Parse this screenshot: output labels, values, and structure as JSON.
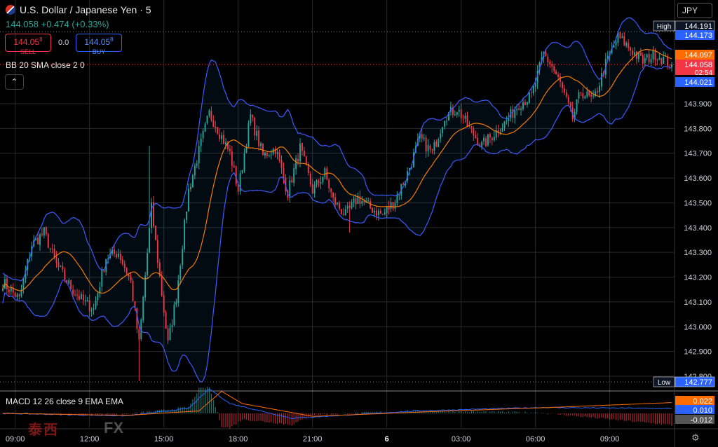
{
  "header": {
    "title": "U.S. Dollar / Japanese Yen · 5",
    "price": "144.058",
    "change": "+0.474",
    "change_pct": "(+0.33%)"
  },
  "trade": {
    "sell_price": "144.05",
    "sell_sup": "8",
    "sell_label": "SELL",
    "spread": "0.0",
    "buy_price": "144.05",
    "buy_sup": "8",
    "buy_label": "BUY"
  },
  "indicators": {
    "bb_label": "BB 20 SMA close 2 0",
    "macd_label": "MACD 12 26 close 9 EMA EMA"
  },
  "currency_select": "JPY",
  "watermark": {
    "left": "泰西",
    "right": "FX"
  },
  "colors": {
    "up": "#26a69a",
    "down": "#f23645",
    "bb_band": "#3d5afe",
    "bb_basis": "#f57c00",
    "macd": "#2962ff",
    "signal": "#ff6d00"
  },
  "chart_data": {
    "type": "candlestick",
    "interval": "5m",
    "y_range": [
      142.78,
      144.25
    ],
    "y_ticks": [
      "143.900",
      "143.800",
      "143.700",
      "143.600",
      "143.500",
      "143.400",
      "143.300",
      "143.200",
      "143.100",
      "143.000",
      "142.900",
      "142.800"
    ],
    "y_tick_values": [
      143.9,
      143.8,
      143.7,
      143.6,
      143.5,
      143.4,
      143.3,
      143.2,
      143.1,
      143.0,
      142.9,
      142.8
    ],
    "x_ticks": [
      "09:00",
      "12:00",
      "15:00",
      "18:00",
      "21:00",
      "6",
      "03:00",
      "06:00",
      "09:00"
    ],
    "x_tick_bars": [
      6,
      42,
      78,
      114,
      150,
      186,
      222,
      258,
      294
    ],
    "bar_count": 325,
    "badges": [
      {
        "label": "High",
        "value": "144.191",
        "price": 144.191
      },
      {
        "label": "",
        "value": "144.173",
        "price": 144.173
      },
      {
        "label": "",
        "value": "144.097",
        "price": 144.097
      },
      {
        "label": "",
        "value": "144.058",
        "price": 144.058,
        "countdown": "02:54"
      },
      {
        "label": "",
        "value": "144.021",
        "price": 144.021
      },
      {
        "label": "Low",
        "value": "142.777",
        "price": 142.777
      }
    ],
    "close_anchors": [
      [
        0,
        143.18
      ],
      [
        8,
        143.11
      ],
      [
        14,
        143.33
      ],
      [
        20,
        143.38
      ],
      [
        26,
        143.25
      ],
      [
        32,
        143.17
      ],
      [
        38,
        143.11
      ],
      [
        44,
        143.07
      ],
      [
        50,
        143.28
      ],
      [
        56,
        143.3
      ],
      [
        62,
        143.18
      ],
      [
        66,
        142.93
      ],
      [
        72,
        143.48
      ],
      [
        76,
        143.2
      ],
      [
        80,
        142.93
      ],
      [
        84,
        143.12
      ],
      [
        90,
        143.55
      ],
      [
        96,
        143.74
      ],
      [
        100,
        143.86
      ],
      [
        104,
        143.8
      ],
      [
        110,
        143.7
      ],
      [
        114,
        143.55
      ],
      [
        120,
        143.85
      ],
      [
        126,
        143.69
      ],
      [
        132,
        143.72
      ],
      [
        138,
        143.54
      ],
      [
        144,
        143.72
      ],
      [
        150,
        143.55
      ],
      [
        156,
        143.62
      ],
      [
        160,
        143.51
      ],
      [
        166,
        143.45
      ],
      [
        172,
        143.52
      ],
      [
        178,
        143.48
      ],
      [
        184,
        143.45
      ],
      [
        190,
        143.51
      ],
      [
        196,
        143.62
      ],
      [
        202,
        143.76
      ],
      [
        208,
        143.7
      ],
      [
        214,
        143.85
      ],
      [
        220,
        143.88
      ],
      [
        226,
        143.8
      ],
      [
        232,
        143.73
      ],
      [
        238,
        143.78
      ],
      [
        244,
        143.83
      ],
      [
        250,
        143.9
      ],
      [
        256,
        143.93
      ],
      [
        262,
        144.1
      ],
      [
        266,
        144.05
      ],
      [
        270,
        143.98
      ],
      [
        276,
        143.84
      ],
      [
        280,
        143.95
      ],
      [
        286,
        143.91
      ],
      [
        292,
        144.06
      ],
      [
        298,
        144.17
      ],
      [
        304,
        144.12
      ],
      [
        310,
        144.07
      ],
      [
        316,
        144.1
      ],
      [
        324,
        144.058
      ]
    ],
    "macd": {
      "value_labels": [
        "0.022",
        "0.010",
        "-0.012"
      ],
      "values": [
        0.022,
        0.01,
        -0.012
      ],
      "series_anchors": [
        [
          0,
          0.0
        ],
        [
          60,
          -0.005
        ],
        [
          90,
          0.01
        ],
        [
          100,
          0.05
        ],
        [
          110,
          0.02
        ],
        [
          140,
          -0.01
        ],
        [
          200,
          0.005
        ],
        [
          260,
          0.012
        ],
        [
          324,
          0.01
        ]
      ],
      "signal_anchors": [
        [
          0,
          0.0
        ],
        [
          60,
          -0.004
        ],
        [
          95,
          0.005
        ],
        [
          106,
          0.045
        ],
        [
          116,
          0.02
        ],
        [
          150,
          -0.006
        ],
        [
          210,
          0.004
        ],
        [
          265,
          0.012
        ],
        [
          324,
          0.022
        ]
      ]
    }
  }
}
